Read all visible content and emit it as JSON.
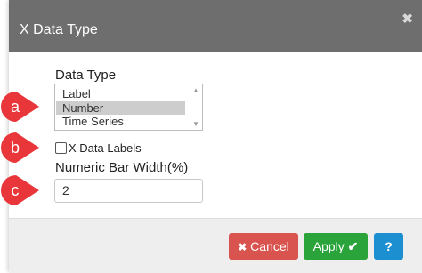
{
  "dialog": {
    "title": "X Data Type",
    "close_glyph": "✖"
  },
  "data_type": {
    "label": "Data Type",
    "options": [
      "Label",
      "Number",
      "Time Series"
    ],
    "selected": "Number"
  },
  "x_data_labels": {
    "label": "X Data Labels",
    "checked": false
  },
  "numeric_bar_width": {
    "label": "Numeric Bar Width(%)",
    "value": "2"
  },
  "buttons": {
    "cancel": "Cancel",
    "apply": "Apply",
    "help": "?"
  },
  "callouts": [
    "a",
    "b",
    "c"
  ],
  "colors": {
    "header": "#6e6e6e",
    "callout": "#e8363a",
    "cancel": "#d9534f",
    "apply": "#2aa33a",
    "help": "#1b8fcf"
  },
  "icons": {
    "cancel": "times-icon",
    "apply": "check-icon",
    "close": "close-icon"
  }
}
